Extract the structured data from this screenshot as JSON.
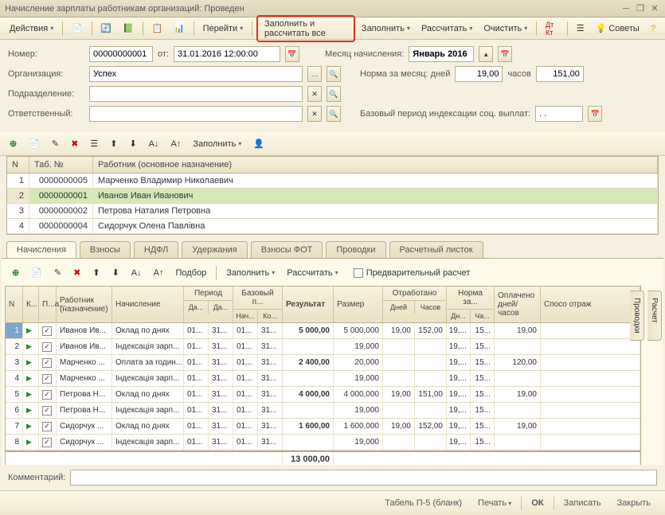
{
  "title": "Начисление зарплаты работникам организаций: Проведен",
  "toolbar": {
    "actions": "Действия",
    "go": "Перейти",
    "fill_calc_all": "Заполнить и рассчитать все",
    "fill": "Заполнить",
    "calc": "Рассчитать",
    "clear": "Очистить",
    "tips": "Советы"
  },
  "form": {
    "number_lbl": "Номер:",
    "number": "00000000001",
    "from_lbl": "от:",
    "date": "31.01.2016 12:00:00",
    "month_lbl": "Месяц начисления:",
    "month": "Январь 2016",
    "org_lbl": "Организация:",
    "org": "Успех",
    "norm_lbl": "Норма за месяц: дней",
    "norm_days": "19,00",
    "hours_lbl": "часов",
    "norm_hours": "151,00",
    "dept_lbl": "Подразделение:",
    "dept": "",
    "resp_lbl": "Ответственный:",
    "resp": "",
    "base_period_lbl": "Базовый период индексации соц. выплат:",
    "base_period": ". ."
  },
  "sub_tb": {
    "fill": "Заполнить"
  },
  "grid1": {
    "cols": {
      "n": "N",
      "tab": "Таб. №",
      "emp": "Работник (основное назначение)"
    },
    "rows": [
      {
        "n": "1",
        "tab": "0000000005",
        "emp": "Марченко Владимир Николаевич"
      },
      {
        "n": "2",
        "tab": "0000000001",
        "emp": "Иванов Иван Иванович"
      },
      {
        "n": "3",
        "tab": "0000000002",
        "emp": "Петрова Наталия Петровна"
      },
      {
        "n": "4",
        "tab": "0000000004",
        "emp": "Сидорчук Олена Павлівна"
      }
    ]
  },
  "tabs": {
    "t1": "Начисления",
    "t2": "Взносы",
    "t3": "НДФЛ",
    "t4": "Удержания",
    "t5": "Взносы ФОТ",
    "t6": "Проводки",
    "t7": "Расчетный листок"
  },
  "dtb": {
    "pick": "Подбор",
    "fill": "Заполнить",
    "calc": "Рассчитать",
    "prelim": "Предварительный расчет"
  },
  "dg": {
    "cols": {
      "n": "N",
      "k": "К...",
      "p": "П...а...",
      "emp": "Работник (назначение)",
      "accr": "Начисление",
      "period": "Период",
      "base": "Базовый п...",
      "result": "Результат",
      "size": "Размер",
      "worked": "Отработано",
      "norm": "Норма за...",
      "paid": "Оплачено дней/часов",
      "way": "Спосо отраж",
      "da": "Да...",
      "na": "Нач...",
      "ko": "Ко...",
      "days": "Дней",
      "hours": "Часов",
      "dn": "Дн...",
      "ch": "Ча..."
    },
    "rows": [
      {
        "n": "1",
        "emp": "Иванов Ив...",
        "accr": "Оклад по днях",
        "p1": "01...",
        "p2": "31...",
        "b1": "01...",
        "b2": "31...",
        "res": "5 000,00",
        "size": "5 000,000",
        "wd": "19,00",
        "wh": "152,00",
        "nd": "19,...",
        "nh": "15...",
        "paid": "19,00"
      },
      {
        "n": "2",
        "emp": "Иванов Ив...",
        "accr": "Індексація зарп...",
        "p1": "01...",
        "p2": "31...",
        "b1": "01...",
        "b2": "31...",
        "res": "",
        "size": "19,000",
        "wd": "",
        "wh": "",
        "nd": "19,...",
        "nh": "15...",
        "paid": ""
      },
      {
        "n": "3",
        "emp": "Марченко ...",
        "accr": "Оплата за годин...",
        "p1": "01...",
        "p2": "31...",
        "b1": "01...",
        "b2": "31...",
        "res": "2 400,00",
        "size": "20,000",
        "wd": "",
        "wh": "",
        "nd": "19,...",
        "nh": "15...",
        "paid": "120,00"
      },
      {
        "n": "4",
        "emp": "Марченко ...",
        "accr": "Індексація зарп...",
        "p1": "01...",
        "p2": "31...",
        "b1": "01...",
        "b2": "31...",
        "res": "",
        "size": "19,000",
        "wd": "",
        "wh": "",
        "nd": "19,...",
        "nh": "15...",
        "paid": ""
      },
      {
        "n": "5",
        "emp": "Петрова Н...",
        "accr": "Оклад по днях",
        "p1": "01...",
        "p2": "31...",
        "b1": "01...",
        "b2": "31...",
        "res": "4 000,00",
        "size": "4 000,000",
        "wd": "19,00",
        "wh": "151,00",
        "nd": "19,...",
        "nh": "15...",
        "paid": "19,00"
      },
      {
        "n": "6",
        "emp": "Петрова Н...",
        "accr": "Індексація зарп...",
        "p1": "01...",
        "p2": "31...",
        "b1": "01...",
        "b2": "31...",
        "res": "",
        "size": "19,000",
        "wd": "",
        "wh": "",
        "nd": "19,...",
        "nh": "15...",
        "paid": ""
      },
      {
        "n": "7",
        "emp": "Сидорчук ...",
        "accr": "Оклад по днях",
        "p1": "01...",
        "p2": "31...",
        "b1": "01...",
        "b2": "31...",
        "res": "1 600,00",
        "size": "1 600,000",
        "wd": "19,00",
        "wh": "152,00",
        "nd": "19,...",
        "nh": "15...",
        "paid": "19,00"
      },
      {
        "n": "8",
        "emp": "Сидорчук ...",
        "accr": "Індексація зарп...",
        "p1": "01...",
        "p2": "31...",
        "b1": "01...",
        "b2": "31...",
        "res": "",
        "size": "19,000",
        "wd": "",
        "wh": "",
        "nd": "19,...",
        "nh": "15...",
        "paid": ""
      }
    ],
    "total": "13 000,00"
  },
  "side": {
    "calc": "Расчет",
    "post": "Проводки"
  },
  "comment_lbl": "Комментарий:",
  "comment": "",
  "bottom": {
    "tabel": "Табель П-5 (бланк)",
    "print": "Печать",
    "ok": "ОК",
    "save": "Записать",
    "close": "Закрыть"
  }
}
